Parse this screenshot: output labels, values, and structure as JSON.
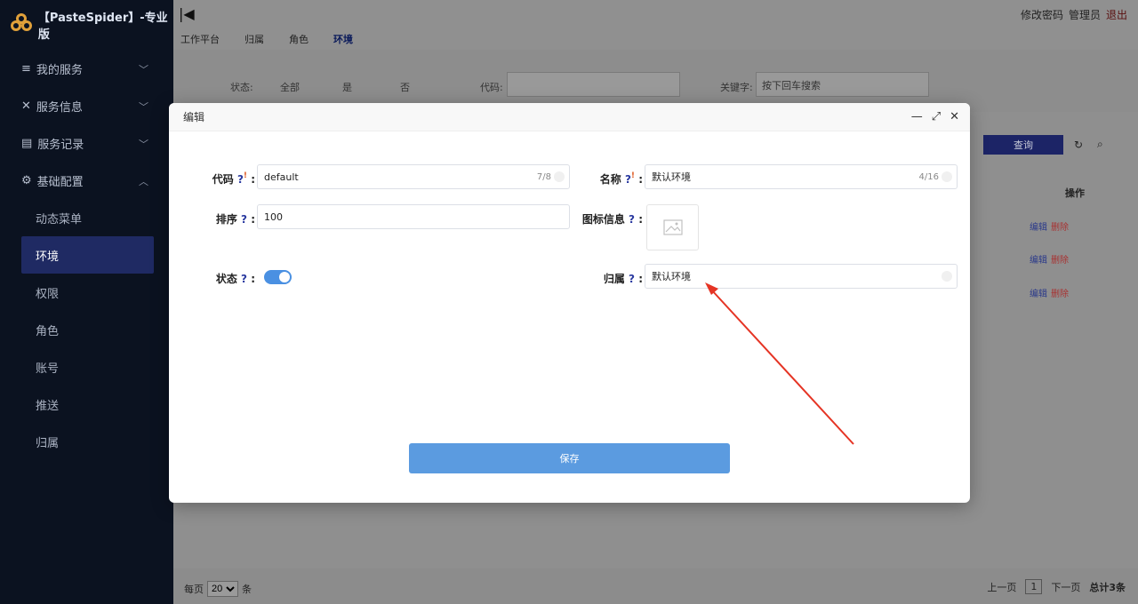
{
  "app": {
    "logo_text": "【PasteSpider】-专业版"
  },
  "sidebar": {
    "menus": [
      {
        "label": "我的服务",
        "icon": "menu-icon"
      },
      {
        "label": "服务信息",
        "icon": "tools-icon"
      },
      {
        "label": "服务记录",
        "icon": "file-icon"
      },
      {
        "label": "基础配置",
        "icon": "gear-icon"
      }
    ],
    "sub_items": [
      "动态菜单",
      "环境",
      "权限",
      "角色",
      "账号",
      "推送",
      "归属"
    ]
  },
  "header": {
    "tabs": [
      "工作平台",
      "归属",
      "角色",
      "环境"
    ],
    "right_links": [
      "修改密码",
      "管理员",
      "退出"
    ]
  },
  "filter": {
    "status_label": "状态:",
    "options": [
      "全部",
      "是",
      "否"
    ],
    "code_label": "代码:",
    "keyword_label": "关键字:",
    "keyword_placeholder": "按下回车搜索"
  },
  "list": {
    "query_btn": "查询",
    "op_head": "操作",
    "edit": "编辑",
    "delete": "删除"
  },
  "footer": {
    "per_page_label": "每页",
    "per_page_value": "20",
    "per_page_unit": "条",
    "prev": "上一页",
    "page": "1",
    "next": "下一页",
    "total": "总计3条"
  },
  "modal": {
    "title": "编辑",
    "code_label": "代码",
    "code_value": "default",
    "code_counter": "7/8",
    "name_label": "名称",
    "name_value": "默认环境",
    "name_counter": "4/16",
    "sort_label": "排序",
    "sort_value": "100",
    "icon_label": "图标信息",
    "status_label": "状态",
    "status_on": true,
    "owner_label": "归属",
    "owner_value": "默认环境",
    "save_label": "保存"
  },
  "colors": {
    "sidebar_bg": "#0b1220",
    "accent": "#5b9be0",
    "annotation_arrow": "#e53424"
  }
}
